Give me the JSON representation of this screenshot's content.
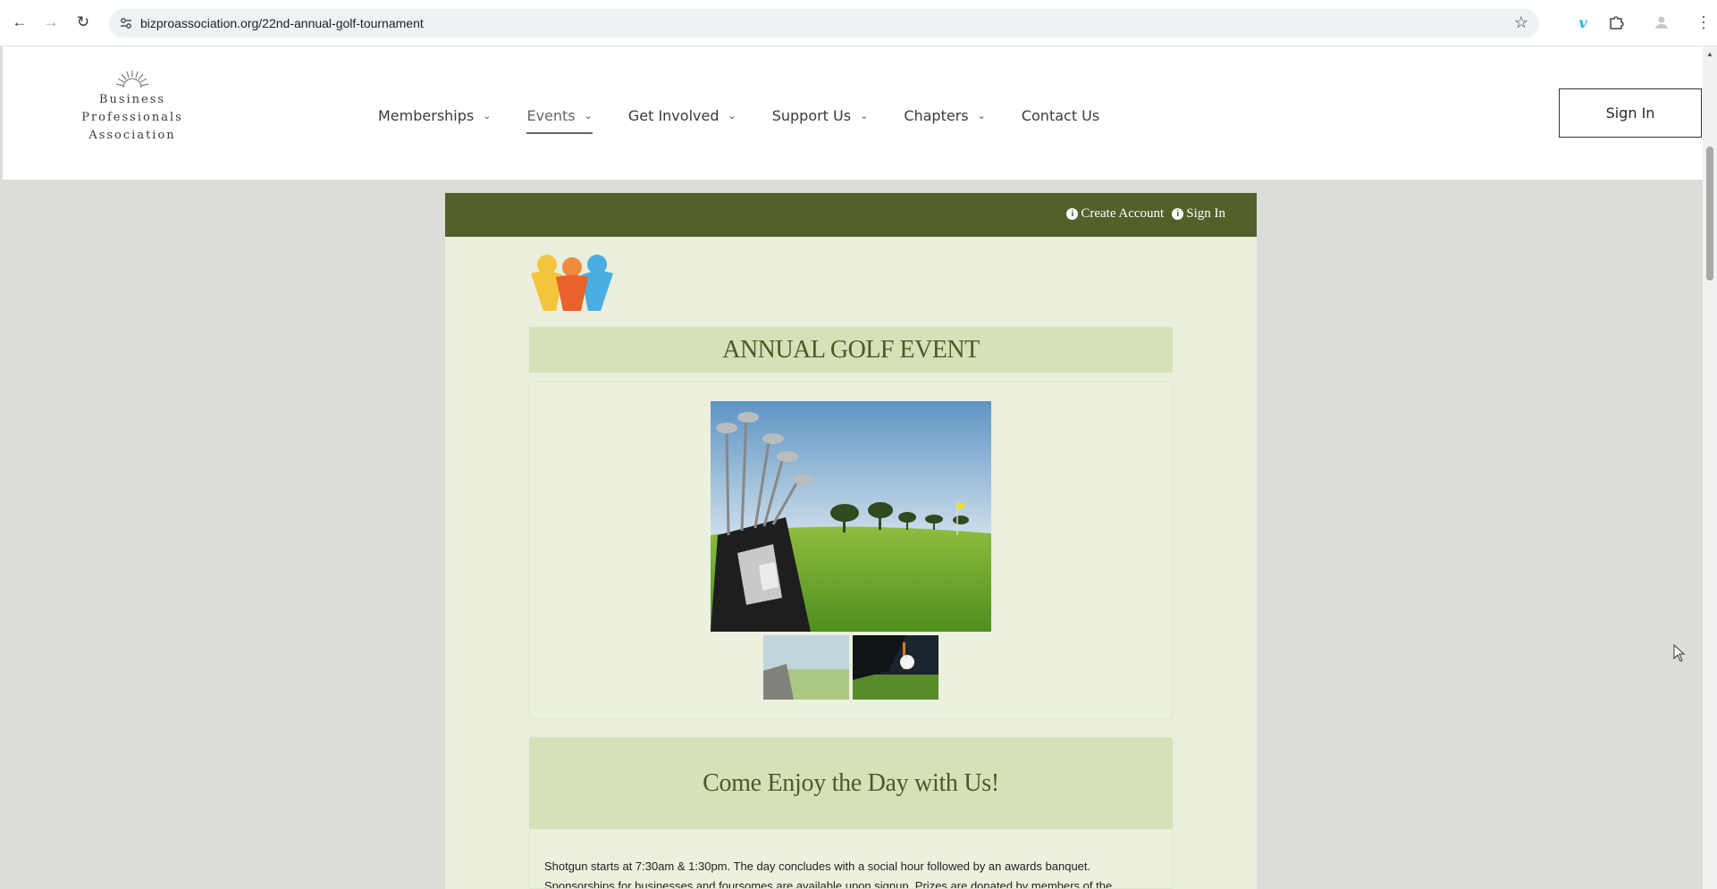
{
  "browser": {
    "url": "bizproassociation.org/22nd-annual-golf-tournament",
    "icons": [
      "back-arrow-icon",
      "forward-arrow-icon",
      "reload-icon",
      "site-settings-icon",
      "bookmark-star-icon",
      "vimeo-extension-icon",
      "extensions-puzzle-icon",
      "profile-icon",
      "kebab-menu-icon"
    ]
  },
  "header": {
    "logo_lines": [
      "Business",
      "Professionals",
      "Association"
    ],
    "nav": [
      {
        "label": "Memberships",
        "has_dropdown": true
      },
      {
        "label": "Events",
        "has_dropdown": true,
        "active": true
      },
      {
        "label": "Get Involved",
        "has_dropdown": true
      },
      {
        "label": "Support Us",
        "has_dropdown": true
      },
      {
        "label": "Chapters",
        "has_dropdown": true
      },
      {
        "label": "Contact Us",
        "has_dropdown": false
      }
    ],
    "sign_in": "Sign In"
  },
  "topbar": {
    "create_account": "Create Account",
    "sign_in": "Sign In",
    "color": "#52602a"
  },
  "event": {
    "title": "ANNUAL GOLF EVENT",
    "section_heading": "Come Enjoy the Day with Us!",
    "body_line1": "Shotgun starts at 7:30am & 1:30pm. The day concludes with a social hour followed by an awards banquet.",
    "body_line2": "Sponsorships for businesses and foursomes are available upon signup. Prizes are donated by members of the"
  },
  "colors": {
    "panel_bg": "#e9eedd",
    "band_bg": "#d5e2b9",
    "heading_text": "#4b5a24",
    "page_bg": "#dcdcd8"
  }
}
